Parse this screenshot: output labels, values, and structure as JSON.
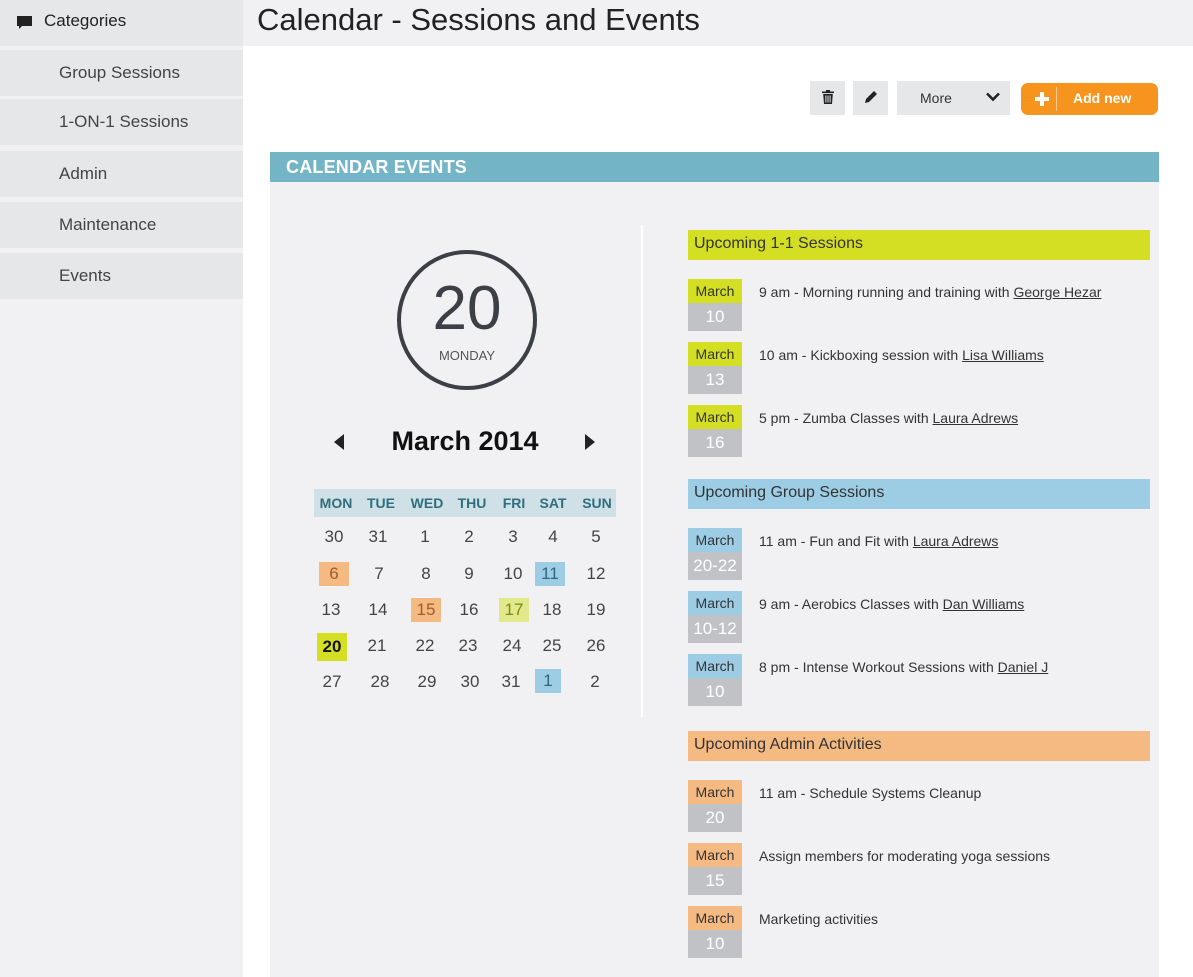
{
  "sidebar": {
    "header": "Categories",
    "items": [
      "Group Sessions",
      "1-ON-1 Sessions",
      "Admin",
      "Maintenance",
      "Events"
    ]
  },
  "header": {
    "title": "Calendar - Sessions and Events"
  },
  "toolbar": {
    "more_label": "More",
    "add_label": "Add new"
  },
  "panel": {
    "title": "CALENDAR EVENTS"
  },
  "calendar": {
    "selected_day": "20",
    "selected_weekday": "MONDAY",
    "month_title": "March 2014",
    "weekdays": [
      "MON",
      "TUE",
      "WED",
      "THU",
      "FRI",
      "SAT",
      "SUN"
    ],
    "weeks": [
      [
        "30",
        "31",
        "1",
        "2",
        "3",
        "4",
        "5"
      ],
      [
        "6",
        "7",
        "8",
        "9",
        "10",
        "11",
        "12"
      ],
      [
        "13",
        "14",
        "15",
        "16",
        "17",
        "18",
        "19"
      ],
      [
        "20",
        "21",
        "22",
        "23",
        "24",
        "25",
        "26"
      ],
      [
        "27",
        "28",
        "29",
        "30",
        "31",
        "1",
        "2"
      ]
    ]
  },
  "colors": {
    "lime": "#d4de23",
    "blue": "#9dcde4",
    "orange": "#f5b982",
    "panel_header": "#73b5c7",
    "add_button": "#f7941d"
  },
  "sections": [
    {
      "title": "Upcoming 1-1 Sessions",
      "color": "#d4de23",
      "events": [
        {
          "month": "March",
          "day": "10",
          "text": "9 am - Morning running and training with ",
          "link": "George Hezar"
        },
        {
          "month": "March",
          "day": "13",
          "text": "10 am - Kickboxing session with ",
          "link": "Lisa Williams"
        },
        {
          "month": "March",
          "day": "16",
          "text": "5 pm - Zumba Classes with ",
          "link": "Laura Adrews"
        }
      ]
    },
    {
      "title": "Upcoming Group Sessions",
      "color": "#9dcde4",
      "events": [
        {
          "month": "March",
          "day": "20-22",
          "text": "11 am - Fun and Fit with ",
          "link": "Laura Adrews"
        },
        {
          "month": "March",
          "day": "10-12",
          "text": "9 am - Aerobics Classes with ",
          "link": "Dan Williams"
        },
        {
          "month": "March",
          "day": "10",
          "text": "8 pm - Intense Workout Sessions with ",
          "link": "Daniel J"
        }
      ]
    },
    {
      "title": "Upcoming Admin Activities",
      "color": "#f5b982",
      "events": [
        {
          "month": "March",
          "day": "20",
          "text": "11 am - Schedule Systems Cleanup",
          "link": ""
        },
        {
          "month": "March",
          "day": "15",
          "text": "Assign members for moderating yoga sessions",
          "link": ""
        },
        {
          "month": "March",
          "day": "10",
          "text": "Marketing activities",
          "link": ""
        }
      ]
    }
  ]
}
